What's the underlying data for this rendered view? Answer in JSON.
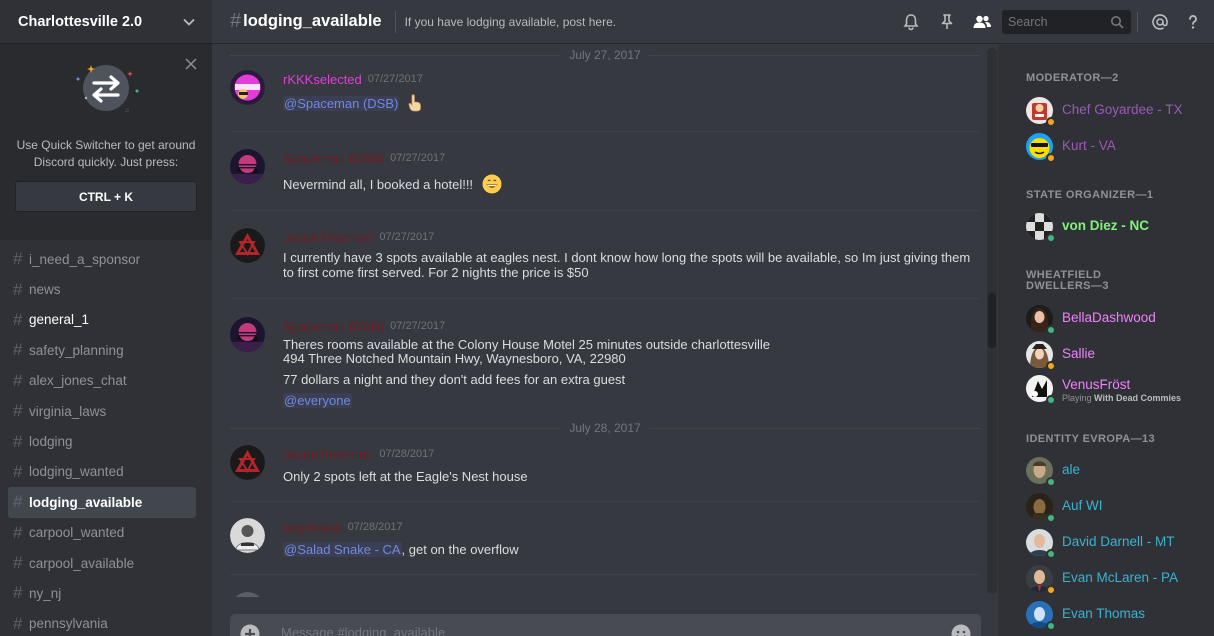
{
  "server": {
    "name": "Charlottesville 2.0"
  },
  "quick_switcher": {
    "text_line1": "Use Quick Switcher to get around",
    "text_line2": "Discord quickly. Just press:",
    "shortcut": "CTRL + K"
  },
  "channels": [
    {
      "name": "i_need_a_sponsor",
      "state": "normal"
    },
    {
      "name": "news",
      "state": "normal"
    },
    {
      "name": "general_1",
      "state": "unread"
    },
    {
      "name": "safety_planning",
      "state": "normal"
    },
    {
      "name": "alex_jones_chat",
      "state": "normal"
    },
    {
      "name": "virginia_laws",
      "state": "normal"
    },
    {
      "name": "lodging",
      "state": "normal"
    },
    {
      "name": "lodging_wanted",
      "state": "normal"
    },
    {
      "name": "lodging_available",
      "state": "active"
    },
    {
      "name": "carpool_wanted",
      "state": "normal"
    },
    {
      "name": "carpool_available",
      "state": "normal"
    },
    {
      "name": "ny_nj",
      "state": "normal"
    },
    {
      "name": "pennsylvania",
      "state": "normal"
    }
  ],
  "channel_header": {
    "name": "lodging_available",
    "topic": "If you have lodging available, post here.",
    "search_placeholder": "Search"
  },
  "messages": {
    "date1": "July 27, 2017",
    "date2": "July 28, 2017",
    "m1": {
      "author": "rKKKselected",
      "author_color": "#e33dd9",
      "time": "07/27/2017",
      "mention": "@Spaceman (DSB)"
    },
    "m2": {
      "author": "Spaceman (DSB)",
      "author_color": "#6e1e24",
      "time": "07/27/2017",
      "text": "Nevermind all, I booked a hotel!!!"
    },
    "m3": {
      "author": "Jacob Freeman",
      "author_color": "#6e1e24",
      "time": "07/27/2017",
      "text1": "I currently have 3 spots available at eagles nest. I dont know how long the spots will be available, so Im just giving them",
      "text2": "to first come first served. For 2 nights the price is $50"
    },
    "m4": {
      "author": "Spaceman (DSB)",
      "author_color": "#6e1e24",
      "time": "07/27/2017",
      "text1": "Theres rooms available at the Colony House Motel 25 minutes outside charlottesville",
      "text2": "494 Three Notched Mountain Hwy, Waynesboro, VA, 22980",
      "text3": "77 dollars a night and they don't add fees for an extra guest",
      "mention": "@everyone"
    },
    "m5": {
      "author": "Jacob Freeman",
      "author_color": "#6e1e24",
      "time": "07/28/2017",
      "text": "Only 2 spots left at the Eagle's Nest house"
    },
    "m6": {
      "author": "negronaut",
      "author_color": "#6e1e24",
      "time": "07/28/2017",
      "mention": "@Salad Snake - CA",
      "text": ", get on the overflow"
    }
  },
  "composer": {
    "placeholder": "Message #lodging_available"
  },
  "members": {
    "groups": [
      {
        "title": "MODERATOR—2",
        "members": [
          {
            "name": "Chef Goyardee - TX",
            "color": "#9b59b6",
            "status": "#faa61a"
          },
          {
            "name": "Kurt - VA",
            "color": "#9b59b6",
            "status": "#faa61a"
          }
        ]
      },
      {
        "title": "STATE ORGANIZER—1",
        "members": [
          {
            "name": "von Diez - NC",
            "color": "#80f27a",
            "status": "#43b581"
          }
        ]
      },
      {
        "title_line1": "WHEATFIELD",
        "title_line2": "DWELLERS—3",
        "members": [
          {
            "name": "BellaDashwood",
            "color": "#f47fff",
            "status": "#43b581"
          },
          {
            "name": "Sallie",
            "color": "#f47fff",
            "status": "#faa61a"
          },
          {
            "name": "VenusFröst",
            "color": "#f47fff",
            "status": "#43b581",
            "playing_prefix": "Playing",
            "playing_game": "With Dead Commies"
          }
        ]
      },
      {
        "title": "IDENTITY EVROPA—13",
        "members": [
          {
            "name": "ale",
            "color": "#3ab2d1",
            "status": "#43b581"
          },
          {
            "name": "Auf WI",
            "color": "#3ab2d1",
            "status": "#43b581"
          },
          {
            "name": "David Darnell - MT",
            "color": "#3ab2d1",
            "status": "#43b581"
          },
          {
            "name": "Evan McLaren - PA",
            "color": "#3ab2d1",
            "status": "#faa61a"
          },
          {
            "name": "Evan Thomas",
            "color": "#3ab2d1",
            "status": "#43b581"
          }
        ]
      }
    ]
  }
}
